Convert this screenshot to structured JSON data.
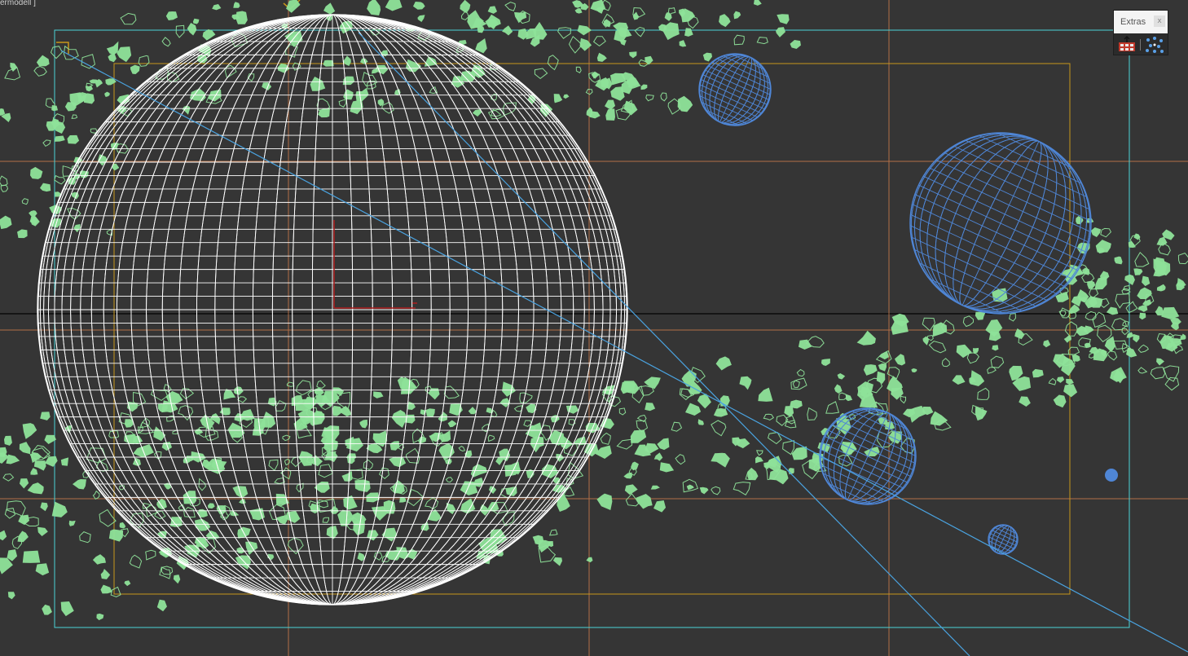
{
  "viewport": {
    "label": "ermodell ]"
  },
  "extras_toolbar": {
    "title": "Extras",
    "close_label": "x",
    "tools": [
      {
        "icon": "array-icon"
      },
      {
        "icon": "scatter-icon"
      }
    ]
  },
  "colors": {
    "background": "#353535",
    "wire_white": "#ffffff",
    "wire_blue": "#4f86d6",
    "particles_green": "#8fe39a",
    "grid_orange": "#c97b4a",
    "safe_frame_yellow": "#c8961a",
    "frame_cyan": "#4ad2d8",
    "camera_blue": "#4aa3e0",
    "axis_red": "#b02020"
  }
}
